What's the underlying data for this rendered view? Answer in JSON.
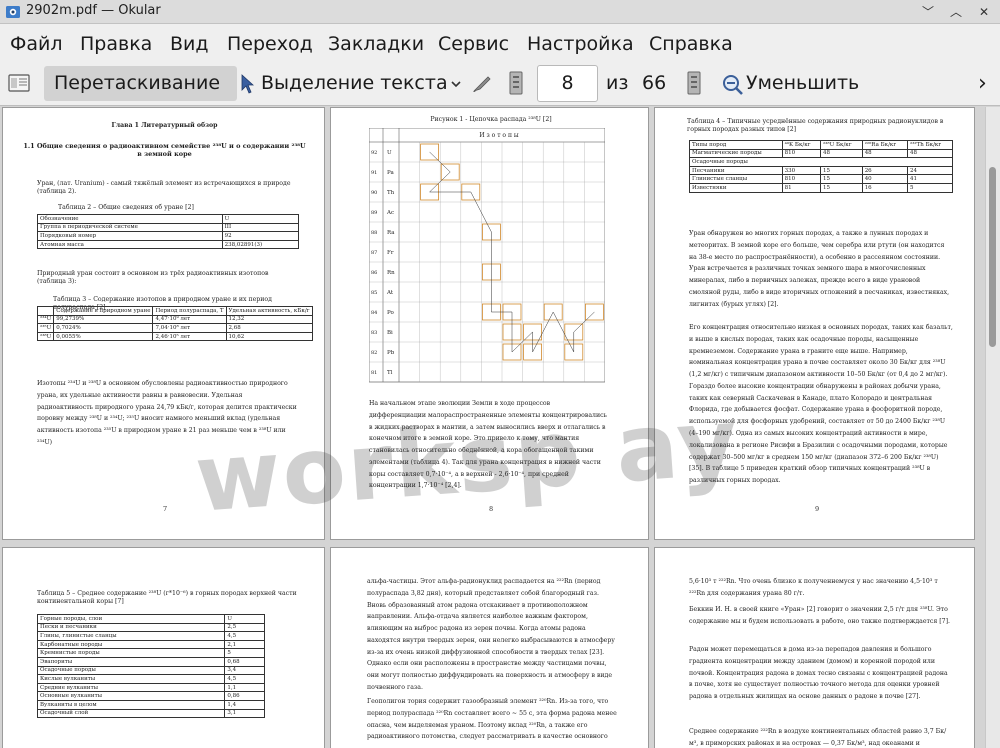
{
  "window": {
    "title": "2902m.pdf  — Okular",
    "controls": [
      "﹀",
      "︿",
      "✕"
    ]
  },
  "menu": [
    "Файл",
    "Правка",
    "Вид",
    "Переход",
    "Закладки",
    "Сервис",
    "Настройка",
    "Справка"
  ],
  "toolbar": {
    "pan_label": "Перетаскивание",
    "select_label": "Выделение текста",
    "page_value": "8",
    "page_of": "из",
    "page_total": "66",
    "zoom_out_label": "Уменьшить",
    "more": "›"
  },
  "watermark": "worksp ay",
  "pages": {
    "p7": {
      "number": "7",
      "chapter": "Глава 1 Литературный обзор",
      "section": "1.1 Общие сведения о радиоактивном семействе ²³⁸U и о содержании ²³⁸U в земной коре",
      "para1": "Уран, (лат. Uranium) - самый тяжёлый элемент из встречающихся в природе (таблица 2).",
      "table2_caption": "Таблица 2 – Общие сведения об уране [2]",
      "table2": [
        [
          "Обозначение",
          "U"
        ],
        [
          "Группа в периодической системе",
          "III"
        ],
        [
          "Порядковый номер",
          "92"
        ],
        [
          "Атомная масса",
          "238,02891(3)"
        ]
      ],
      "para2": "Природный уран состоит в основном из трёх радиоактивных изотопов (таблица 3):",
      "table3_caption": "Таблица 3 – Содержание изотопов в природном уране и их период полураспада [2]",
      "table3_header": [
        "",
        "Содержание в природном уране",
        "Период полураспада, T",
        "Удельная активность, кБк/г"
      ],
      "table3": [
        [
          "²³⁴U",
          "99,2739%",
          "4,47·10⁹ лет",
          "12,32"
        ],
        [
          "²³⁵U",
          "0,7024%",
          "7,04·10⁸ лет",
          "2,68"
        ],
        [
          "²³⁸U",
          "0,0055%",
          "2,46·10⁵ лет",
          "10,62"
        ]
      ],
      "para3": "Изотопы ²³⁴U и ²³⁸U в основном обусловлены радиоактивностью природного урана, их удельные активности равны в равновесии. Удельная радиоактивность природного урана 24,79 кБк/г, которая делится практически поровну между ²³⁸U и ²³⁴U; ²³⁵U вносит намного меньший вклад (удельная активность изотопа ²³⁵U в природном уране в 21 раз меньше чем в ²³⁸U или ²³⁴U)"
    },
    "p8": {
      "number": "8",
      "figure_caption": "Рисунок 1 - Цепочка распада ²³⁸U [2]",
      "grid_header": "И з о т о п ы",
      "elements": [
        "U",
        "Pa",
        "Th",
        "Ac",
        "Ra",
        "Fr",
        "Rn",
        "At",
        "Po",
        "Bi",
        "Pb",
        "Tl"
      ],
      "numbers": [
        "92",
        "91",
        "90",
        "89",
        "88",
        "87",
        "86",
        "85",
        "84",
        "83",
        "82",
        "81"
      ],
      "para": "На начальном этапе эволюции Земли в ходе процессов дифференциации малораспространенные элементы концентрировались в жидких растворах в мантии, а затем выносились вверх и отлагались в конечном итоге в земной коре. Это привело к тому, что мантия становилась относительно обеднённой, а кора обогащенной такими элементами (таблица 4). Так для урана концентрация в нижней части коры составляет 0,7·10⁻⁴, а в верхней - 2,6·10⁻⁴, при средней концентрации 1,7·10⁻⁴ [2,4]."
    },
    "p9": {
      "number": "9",
      "table4_caption": "Таблица 4 – Типичные усреднённые содержания природных радионуклидов в горных породах разных типов [2]",
      "table4_header": [
        "Типы пород",
        "⁴⁰K Бк/кг",
        "²³⁸U Бк/кг",
        "²²⁶Ra Бк/кг",
        "²³²Th Бк/кг"
      ],
      "table4": [
        [
          "Магматические породы",
          "810",
          "48",
          "48",
          "48"
        ],
        [
          "Осадочные породы",
          "",
          "",
          "",
          ""
        ],
        [
          "Песчаники",
          "330",
          "15",
          "26",
          "24"
        ],
        [
          "Глинистые сланцы",
          "810",
          "15",
          "40",
          "41"
        ],
        [
          "Известняки",
          "81",
          "15",
          "16",
          "5"
        ]
      ],
      "para1": "Уран обнаружен во многих горных породах, а также в лунных породах и метеоритах. В земной коре его больше, чем серебра или ртути (он находится на 38-е место по распространённости), а особенно в рассеянном состоянии. Уран встречается в различных точках земного шара в многочисленных минералах, либо в первичных залежах, прежде всего в виде урановой смоляной руды, либо в виде вторичных отложений в песчаниках, известняках, лигнитах (бурых углях) [2].",
      "para2": "Его концентрация относительно низкая в основных породах, таких как базальт, и выше в кислых породах, таких как осадочные породы, насыщенные кремнеземом. Содержание урана в граните еще выше. Например, номинальная концентрация урана в почве составляет около 30 Бк/кг для ²³⁸U (1,2 мг/кг) с типичным диапазоном активности 10–50 Бк/кг (от 0,4 до 2 мг/кг). Гораздо более высокие концентрации обнаружены в районах добычи урана, таких как северный Саскачеван в Канаде, плато Колорадо и центральная Флорида, где добывается фосфат. Содержание урана в фосфоритной породе, используемой для фосфорных удобрений, составляет от 50 до 2400 Бк/кг ²³⁸U (4–190 мг/кг). Одна из самых высоких концентраций активности в мире, локализована в регионе Рисифи в Бразилии с осадочными породами, которые содержат 30–500 мг/кг в среднем 150 мг/кг (диапазон 372–6 200 Бк/кг ²³⁸U) [35]. В таблице 5 приведен краткий обзор типичных концентраций ²³⁸U в различных горных породах."
    },
    "p10": {
      "table5_caption": "Таблица 5 – Среднее содержание ²³⁸U (г*10⁻⁶) в горных породах верхней части континентальной коры [7]",
      "table5": [
        [
          "Горные породы, слои",
          "U"
        ],
        [
          "Пески и песчаники",
          "2,5"
        ],
        [
          "Глины, глинистые сланцы",
          "4,5"
        ],
        [
          "Карбонатные породы",
          "2,1"
        ],
        [
          "Кремнистые породы",
          "5"
        ],
        [
          "Эвапориты",
          "0,68"
        ],
        [
          "Осадочные породы",
          "3,4"
        ],
        [
          "Кислые вулканиты",
          "4,5"
        ],
        [
          "Средние вулканиты",
          "1,1"
        ],
        [
          "Основные вулканиты",
          "0,86"
        ],
        [
          "Вулканиты в целом",
          "1,4"
        ],
        [
          "Осадочный слой",
          "3,1"
        ]
      ]
    },
    "p11": {
      "para1": "альфа-частицы. Этот альфа-радионуклид распадается на ²²²Rn (период полураспада 3,82 дня), который представляет собой благородный газ. Вновь образованный атом радона отскакивает в противоположном направлении. Альфа-отдача является наиболее важным фактором, влияющим на выброс радона из зерен почвы. Когда атомы радона находятся внутри твердых зерен, они нелегко выбрасываются в атмосферу из-за их очень низкой диффузионной способности в твердых телах [23]. Однако если они расположены в пространстве между частицами почвы, они могут полностью диффундировать на поверхность и атмосферу в виде почвенного газа.",
      "para2": "Геополигон тория содержит газообразный элемент ²²⁰Rn. Из-за того, что период полураспада ²²⁰Rn составляет всего ~ 55 с, эта форма радона менее опасна, чем выделяемая ураном. Поэтому вклад ²²⁰Rn, а также его радиоактивного потомства, следует рассматривать в качестве основного"
    },
    "p12": {
      "para1": "5,6·10³ т ²²²Rn. Что очень близко к полученнемуся у нас значению 4,5·10³ т ²²²Rn для содержания урана 80 г/т.",
      "para2": "Беккин И. Н. в своей книге «Уран» [2] говорит о значении 2,5 г/т для ²³⁸U. Это содержание мы и будем использовать в работе, оно также подтверждается [7].",
      "para3": "Радон может перемещаться в дома из-за перепадов давления и большого градиента концентрации между зданием (домом) и коренной породой или почвой. Концентрация радона в домах тесно связаны с концентрацией радона в почве, хотя не существует полностью точного метода для оценки уровней радона в отдельных жилищах на основе данных о радоне в почве [27].",
      "para4": "Среднее содержание ²²²Rn в воздухе континентальных областей равно 3,7 Бк/м³, в приморских районах и на островах — 0,37 Бк/м³, над океанами и"
    }
  }
}
